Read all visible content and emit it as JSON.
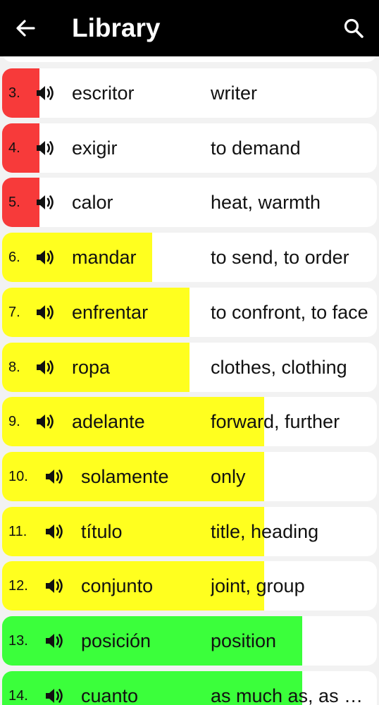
{
  "header": {
    "title": "Library",
    "back_icon": "arrow-left-icon",
    "search_icon": "search-icon"
  },
  "colors": {
    "red": "#f73a3a",
    "yellow": "#ffff1f",
    "green": "#3bff3b",
    "header_bg": "#000000"
  },
  "words": [
    {
      "number": "3.",
      "word": "escritor",
      "meaning": "writer",
      "color": "#f73a3a",
      "progress": 0.1
    },
    {
      "number": "4.",
      "word": "exigir",
      "meaning": "to demand",
      "color": "#f73a3a",
      "progress": 0.1
    },
    {
      "number": "5.",
      "word": "calor",
      "meaning": "heat, warmth",
      "color": "#f73a3a",
      "progress": 0.1
    },
    {
      "number": "6.",
      "word": "mandar",
      "meaning": "to send, to order",
      "color": "#ffff1f",
      "progress": 0.4
    },
    {
      "number": "7.",
      "word": "enfrentar",
      "meaning": "to confront, to face",
      "color": "#ffff1f",
      "progress": 0.5
    },
    {
      "number": "8.",
      "word": "ropa",
      "meaning": "clothes, clothing",
      "color": "#ffff1f",
      "progress": 0.5
    },
    {
      "number": "9.",
      "word": "adelante",
      "meaning": "forward, further",
      "color": "#ffff1f",
      "progress": 0.7
    },
    {
      "number": "10.",
      "word": "solamente",
      "meaning": "only",
      "color": "#ffff1f",
      "progress": 0.7
    },
    {
      "number": "11.",
      "word": "título",
      "meaning": "title, heading",
      "color": "#ffff1f",
      "progress": 0.7
    },
    {
      "number": "12.",
      "word": "conjunto",
      "meaning": "joint, group",
      "color": "#ffff1f",
      "progress": 0.7
    },
    {
      "number": "13.",
      "word": "posición",
      "meaning": "position",
      "color": "#3bff3b",
      "progress": 0.8
    },
    {
      "number": "14.",
      "word": "cuanto",
      "meaning": "as much as, as many as",
      "color": "#3bff3b",
      "progress": 0.8
    }
  ]
}
